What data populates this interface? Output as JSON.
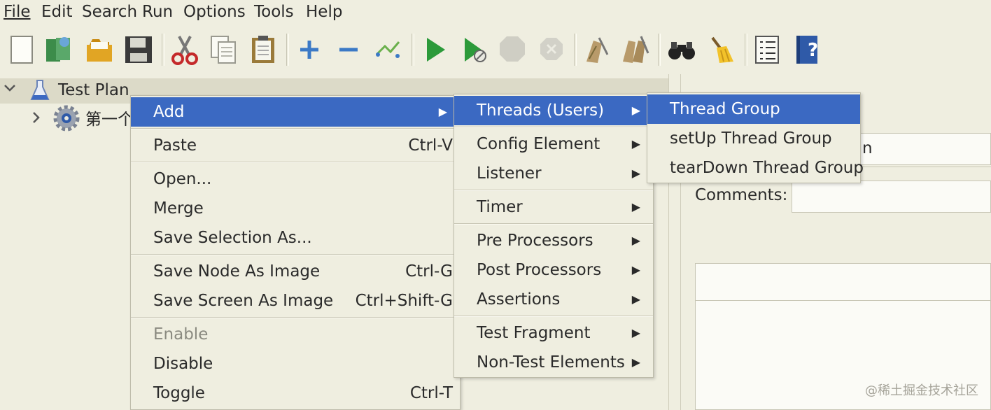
{
  "menubar": {
    "items": [
      "File",
      "Edit",
      "Search",
      "Run",
      "Options",
      "Tools",
      "Help"
    ]
  },
  "toolbar": {
    "icons": [
      "new-icon",
      "templates-icon",
      "open-icon",
      "save-icon",
      "cut-icon",
      "copy-icon",
      "paste-icon",
      "expand-icon",
      "collapse-icon",
      "toggle-icon",
      "start-icon",
      "start-no-pauses-icon",
      "stop-icon",
      "shutdown-icon",
      "clear-icon",
      "clear-all-icon",
      "search-icon",
      "reset-search-icon",
      "function-helper-icon",
      "help-icon"
    ]
  },
  "tree": {
    "root_label": "Test Plan",
    "child_label": "第一个"
  },
  "right_pane": {
    "comments_label": "Comments:",
    "name_suffix": "n"
  },
  "context_menu": {
    "items": [
      {
        "label": "Add",
        "accel": "",
        "submenu": true,
        "selected": true,
        "disabled": false
      },
      {
        "label": "Paste",
        "accel": "Ctrl-V",
        "submenu": false,
        "selected": false,
        "disabled": false
      },
      {
        "label": "Open...",
        "accel": "",
        "submenu": false,
        "selected": false,
        "disabled": false
      },
      {
        "label": "Merge",
        "accel": "",
        "submenu": false,
        "selected": false,
        "disabled": false
      },
      {
        "label": "Save Selection As...",
        "accel": "",
        "submenu": false,
        "selected": false,
        "disabled": false
      },
      {
        "label": "Save Node As Image",
        "accel": "Ctrl-G",
        "submenu": false,
        "selected": false,
        "disabled": false
      },
      {
        "label": "Save Screen As Image",
        "accel": "Ctrl+Shift-G",
        "submenu": false,
        "selected": false,
        "disabled": false
      },
      {
        "label": "Enable",
        "accel": "",
        "submenu": false,
        "selected": false,
        "disabled": true
      },
      {
        "label": "Disable",
        "accel": "",
        "submenu": false,
        "selected": false,
        "disabled": false
      },
      {
        "label": "Toggle",
        "accel": "Ctrl-T",
        "submenu": false,
        "selected": false,
        "disabled": false
      }
    ]
  },
  "add_submenu": {
    "items": [
      {
        "label": "Threads (Users)",
        "selected": true
      },
      {
        "label": "Config Element",
        "selected": false
      },
      {
        "label": "Listener",
        "selected": false
      },
      {
        "label": "Timer",
        "selected": false
      },
      {
        "label": "Pre Processors",
        "selected": false
      },
      {
        "label": "Post Processors",
        "selected": false
      },
      {
        "label": "Assertions",
        "selected": false
      },
      {
        "label": "Test Fragment",
        "selected": false
      },
      {
        "label": "Non-Test Elements",
        "selected": false
      }
    ]
  },
  "threads_submenu": {
    "items": [
      {
        "label": "Thread Group",
        "selected": true
      },
      {
        "label": "setUp Thread Group",
        "selected": false
      },
      {
        "label": "tearDown Thread Group",
        "selected": false
      }
    ]
  },
  "watermark": "@稀土掘金技术社区",
  "colors": {
    "background": "#efeee0",
    "selection": "#3b69c2",
    "selection_text": "#ffffff"
  }
}
